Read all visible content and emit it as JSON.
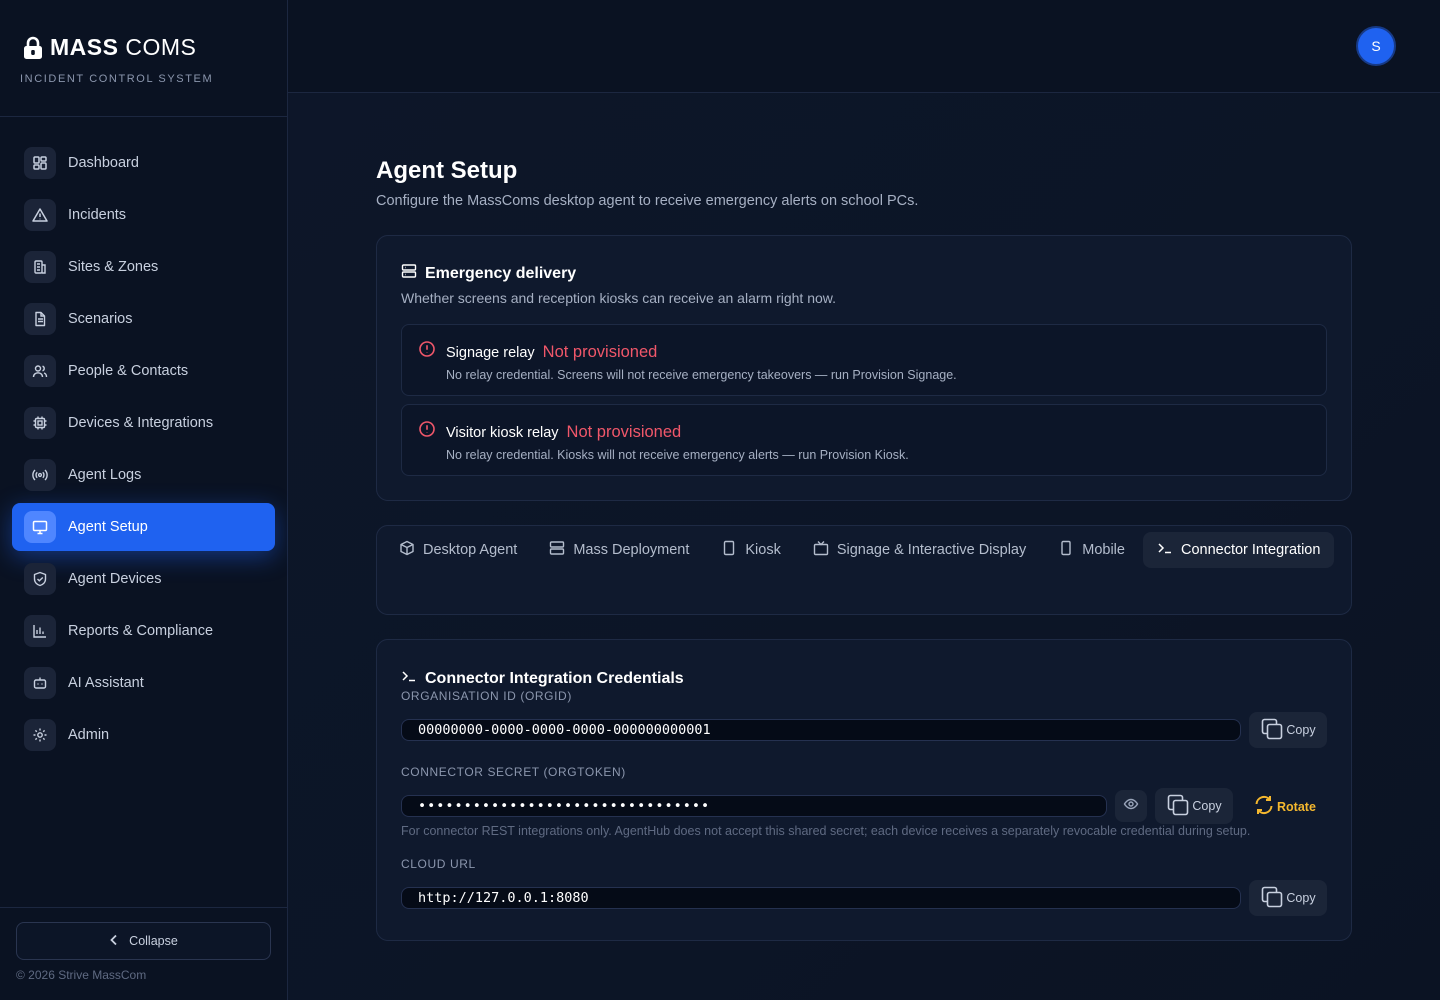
{
  "brand": {
    "name_bold": "MASS",
    "name_light": "COMS",
    "subtitle": "INCIDENT CONTROL SYSTEM"
  },
  "sidebar": {
    "items": [
      {
        "label": "Dashboard",
        "icon": "dashboard-icon"
      },
      {
        "label": "Incidents",
        "icon": "warning-triangle-icon"
      },
      {
        "label": "Sites & Zones",
        "icon": "building-icon"
      },
      {
        "label": "Scenarios",
        "icon": "document-icon"
      },
      {
        "label": "People & Contacts",
        "icon": "users-icon"
      },
      {
        "label": "Devices & Integrations",
        "icon": "chip-icon"
      },
      {
        "label": "Agent Logs",
        "icon": "broadcast-icon"
      },
      {
        "label": "Agent Setup",
        "icon": "monitor-icon",
        "active": true
      },
      {
        "label": "Agent Devices",
        "icon": "shield-check-icon"
      },
      {
        "label": "Reports & Compliance",
        "icon": "bar-chart-icon"
      },
      {
        "label": "AI Assistant",
        "icon": "bot-icon"
      },
      {
        "label": "Admin",
        "icon": "gear-icon"
      }
    ],
    "collapse_label": "Collapse",
    "copyright": "© 2026 Strive MassCom"
  },
  "header": {
    "avatar_initial": "S"
  },
  "page": {
    "title": "Agent Setup",
    "subtitle": "Configure the MassComs desktop agent to receive emergency alerts on school PCs."
  },
  "emergency": {
    "title": "Emergency delivery",
    "subtitle": "Whether screens and reception kiosks can receive an alarm right now.",
    "relays": [
      {
        "name": "Signage relay",
        "status": "Not provisioned",
        "description": "No relay credential. Screens will not receive emergency takeovers — run Provision Signage."
      },
      {
        "name": "Visitor kiosk relay",
        "status": "Not provisioned",
        "description": "No relay credential. Kiosks will not receive emergency alerts — run Provision Kiosk."
      }
    ]
  },
  "tabs": [
    {
      "label": "Desktop Agent",
      "icon": "package-icon"
    },
    {
      "label": "Mass Deployment",
      "icon": "server-icon"
    },
    {
      "label": "Kiosk",
      "icon": "tablet-icon"
    },
    {
      "label": "Signage & Interactive Display",
      "icon": "tv-icon"
    },
    {
      "label": "Mobile",
      "icon": "phone-icon"
    },
    {
      "label": "Connector Integration",
      "icon": "terminal-icon",
      "active": true
    }
  ],
  "credentials": {
    "title": "Connector Integration Credentials",
    "org_id_label": "ORGANISATION ID (ORGID)",
    "org_id_value": "00000000-0000-0000-0000-000000000001",
    "secret_label": "CONNECTOR SECRET (ORGTOKEN)",
    "secret_value": "••••••••••••••••••••••••••••••••",
    "secret_note": "For connector REST integrations only. AgentHub does not accept this shared secret; each device receives a separately revocable credential during setup.",
    "cloud_url_label": "CLOUD URL",
    "cloud_url_value": "http://127.0.0.1:8080",
    "copy_label": "Copy",
    "rotate_label": "Rotate"
  },
  "colors": {
    "accent": "#1f62f0",
    "danger": "#f0576a",
    "warning": "#f5b82e",
    "background": "#0b1324"
  }
}
